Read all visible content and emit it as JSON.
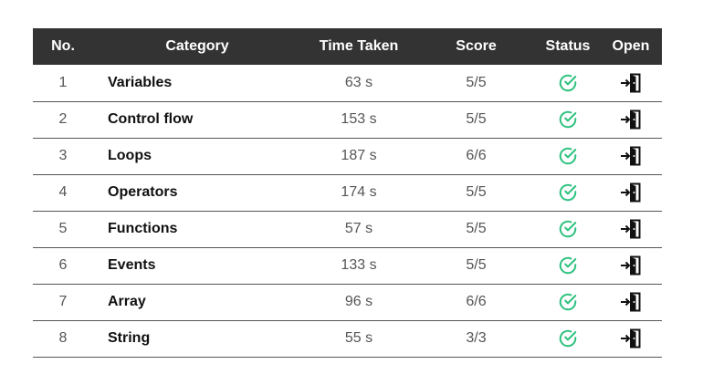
{
  "colors": {
    "header_bg": "#333333",
    "header_text": "#ffffff",
    "status_green": "#2ec27e",
    "row_divider": "#555555"
  },
  "table": {
    "headers": {
      "no": "No.",
      "category": "Category",
      "time": "Time Taken",
      "score": "Score",
      "status": "Status",
      "open": "Open"
    },
    "rows": [
      {
        "no": "1",
        "category": "Variables",
        "time": "63 s",
        "score": "5/5",
        "status_icon": "check-circle-icon",
        "open_icon": "enter-door-icon"
      },
      {
        "no": "2",
        "category": "Control flow",
        "time": "153 s",
        "score": "5/5",
        "status_icon": "check-circle-icon",
        "open_icon": "enter-door-icon"
      },
      {
        "no": "3",
        "category": "Loops",
        "time": "187 s",
        "score": "6/6",
        "status_icon": "check-circle-icon",
        "open_icon": "enter-door-icon"
      },
      {
        "no": "4",
        "category": "Operators",
        "time": "174 s",
        "score": "5/5",
        "status_icon": "check-circle-icon",
        "open_icon": "enter-door-icon"
      },
      {
        "no": "5",
        "category": "Functions",
        "time": "57 s",
        "score": "5/5",
        "status_icon": "check-circle-icon",
        "open_icon": "enter-door-icon"
      },
      {
        "no": "6",
        "category": "Events",
        "time": "133 s",
        "score": "5/5",
        "status_icon": "check-circle-icon",
        "open_icon": "enter-door-icon"
      },
      {
        "no": "7",
        "category": "Array",
        "time": "96 s",
        "score": "6/6",
        "status_icon": "check-circle-icon",
        "open_icon": "enter-door-icon"
      },
      {
        "no": "8",
        "category": "String",
        "time": "55 s",
        "score": "3/3",
        "status_icon": "check-circle-icon",
        "open_icon": "enter-door-icon"
      }
    ]
  }
}
